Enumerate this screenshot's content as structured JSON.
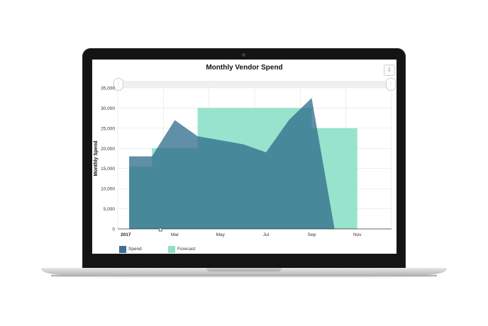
{
  "chart_data": {
    "type": "area",
    "title": "Monthly Vendor Spend",
    "xlabel": "",
    "ylabel": "Monthly Spend",
    "year_label": "2017",
    "x_tick_labels": [
      "Mar",
      "May",
      "Jul",
      "Sep",
      "Nov"
    ],
    "x": [
      "2017-01",
      "2017-02",
      "2017-03",
      "2017-04",
      "2017-05",
      "2017-06",
      "2017-07",
      "2017-08",
      "2017-09",
      "2017-10",
      "2017-11",
      "2017-12"
    ],
    "ylim": [
      0,
      35000
    ],
    "y_ticks": [
      0,
      5000,
      10000,
      15000,
      20000,
      25000,
      30000,
      35000
    ],
    "y_tick_labels": [
      "0",
      "5,000",
      "10,000",
      "15,000",
      "20,000",
      "25,000",
      "30,000",
      "35,000"
    ],
    "grid": true,
    "legend_position": "bottom-left",
    "series": [
      {
        "name": "Forecast",
        "color": "#8de0c8",
        "opacity": 0.9,
        "step": true,
        "values": [
          15500,
          20000,
          20000,
          30000,
          30000,
          30000,
          30000,
          30000,
          25000,
          25000,
          25000
        ]
      },
      {
        "name": "Spend",
        "color": "#2c6a8a",
        "opacity": 0.75,
        "step": false,
        "values": [
          18000,
          18000,
          27000,
          23000,
          22000,
          21000,
          19000,
          27000,
          32500,
          0
        ]
      }
    ]
  }
}
